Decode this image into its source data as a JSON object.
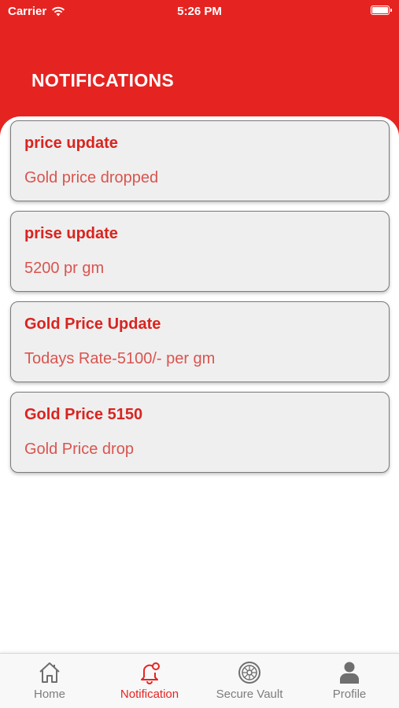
{
  "status_bar": {
    "carrier": "Carrier",
    "time": "5:26 PM"
  },
  "header": {
    "title": "NOTIFICATIONS",
    "background_color": "#e52421"
  },
  "notifications": [
    {
      "title": "price update",
      "body": "Gold price dropped"
    },
    {
      "title": "prise update",
      "body": "5200 pr gm"
    },
    {
      "title": "Gold Price Update",
      "body": "Todays Rate-5100/- per gm"
    },
    {
      "title": "Gold Price 5150",
      "body": "Gold Price drop"
    }
  ],
  "tabbar": {
    "active_color": "#e52421",
    "inactive_color": "#7d7d7d",
    "items": [
      {
        "label": "Home",
        "icon": "home-icon"
      },
      {
        "label": "Notification",
        "icon": "bell-icon",
        "active": true
      },
      {
        "label": "Secure Vault",
        "icon": "vault-icon"
      },
      {
        "label": "Profile",
        "icon": "profile-icon"
      }
    ]
  }
}
